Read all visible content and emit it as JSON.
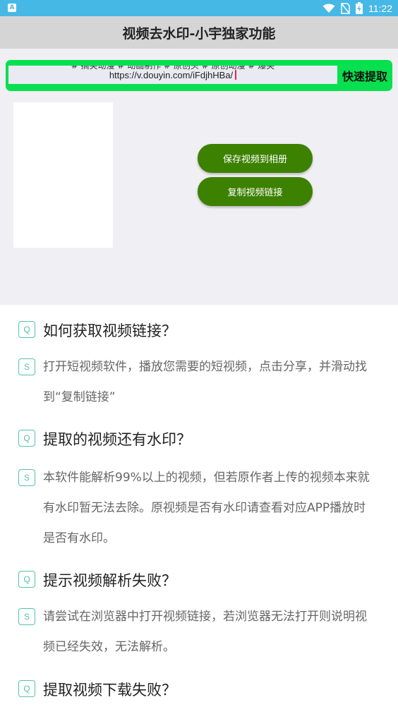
{
  "status_bar": {
    "app_badge": "A",
    "time": "11:22",
    "icons": [
      "wifi-icon",
      "no-sim-icon",
      "battery-charging-icon"
    ]
  },
  "title": "视频去水印-小宇独家功能",
  "url_input": {
    "value_line1": "# 搞笑动漫 # 动画制作 # 原创头 # 原创动漫 # 爆笑",
    "value_line2": "https://v.douyin.com/iFdjhHBa/"
  },
  "buttons": {
    "extract": "快速提取",
    "save_video": "保存视频到相册",
    "copy_link": "复制视频链接"
  },
  "faq": [
    {
      "q_badge": "Q",
      "question": "如何获取视频链接？",
      "a_badge": "S",
      "answer": "打开短视频软件，播放您需要的短视频，点击分享，并滑动找到“复制链接”"
    },
    {
      "q_badge": "Q",
      "question": "提取的视频还有水印？",
      "a_badge": "S",
      "answer": "本软件能解析99%以上的视频，但若原作者上传的视频本来就有水印暂无法去除。原视频是否有水印请查看对应APP播放时是否有水印。"
    },
    {
      "q_badge": "Q",
      "question": "提示视频解析失败？",
      "a_badge": "S",
      "answer": "请尝试在浏览器中打开视频链接，若浏览器无法打开则说明视频已经失效，无法解析。"
    },
    {
      "q_badge": "Q",
      "question": "提取视频下载失败？"
    }
  ]
}
